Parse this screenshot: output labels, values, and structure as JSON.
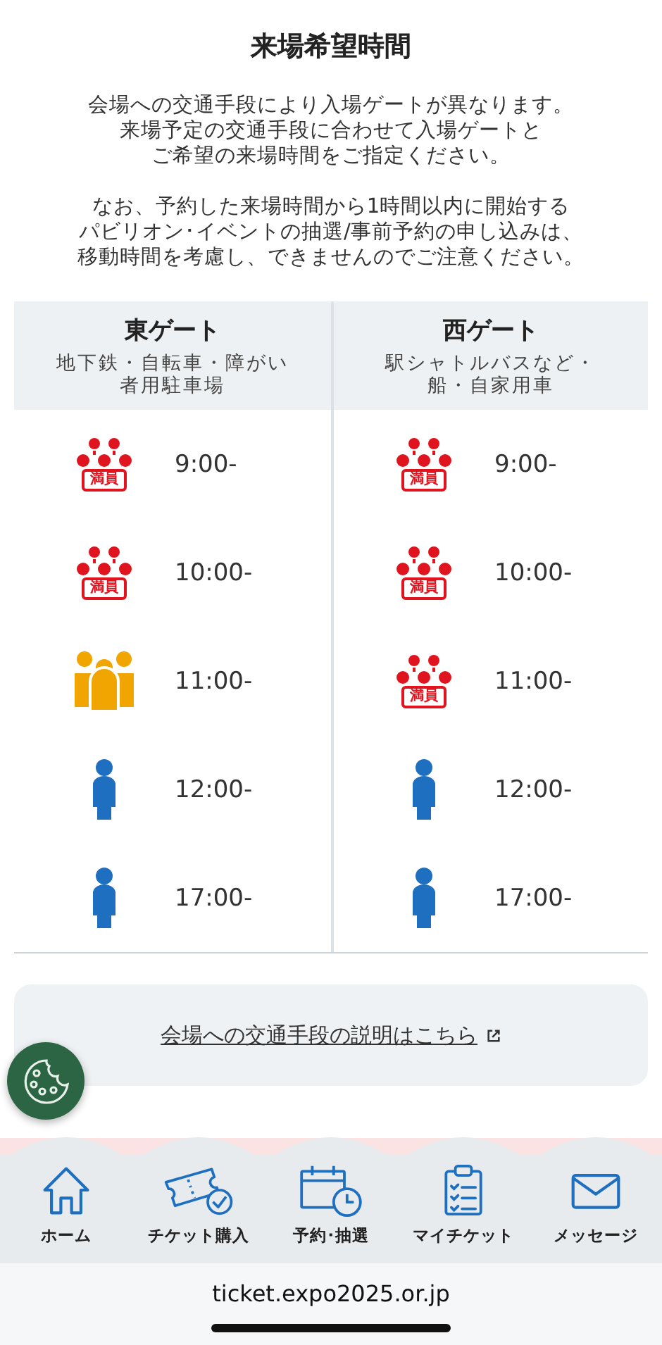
{
  "title": "来場希望時間",
  "intro": [
    "会場への交通手段により入場ゲートが異なります。",
    "来場予定の交通手段に合わせて入場ゲートと",
    "ご希望の来場時間をご指定ください。"
  ],
  "notice": [
    "なお、予約した来場時間から1時間以内に開始する",
    "パビリオン･イベントの抽選/事前予約の申し込みは、",
    "移動時間を考慮し、できませんのでご注意ください。"
  ],
  "gates": [
    {
      "name": "東ゲート",
      "means": [
        "地下鉄・自転車・障がい",
        "者用駐車場"
      ],
      "slots": [
        {
          "kind": "full",
          "badge": "満員",
          "time": "9:00-"
        },
        {
          "kind": "full",
          "badge": "満員",
          "time": "10:00-"
        },
        {
          "kind": "busy",
          "time": "11:00-"
        },
        {
          "kind": "available",
          "time": "12:00-"
        },
        {
          "kind": "available",
          "time": "17:00-"
        }
      ]
    },
    {
      "name": "西ゲート",
      "means": [
        "駅シャトルバスなど・",
        "船・自家用車"
      ],
      "slots": [
        {
          "kind": "full",
          "badge": "満員",
          "time": "9:00-"
        },
        {
          "kind": "full",
          "badge": "満員",
          "time": "10:00-"
        },
        {
          "kind": "full",
          "badge": "満員",
          "time": "11:00-"
        },
        {
          "kind": "available",
          "time": "12:00-"
        },
        {
          "kind": "available",
          "time": "17:00-"
        }
      ]
    }
  ],
  "transport_link": "会場への交通手段の説明はこちら",
  "nav": [
    {
      "kind": "home",
      "label": "ホーム"
    },
    {
      "kind": "ticket",
      "label": "チケット購入"
    },
    {
      "kind": "calendar",
      "label": "予約･抽選"
    },
    {
      "kind": "clipboard",
      "label": "マイチケット"
    },
    {
      "kind": "mail",
      "label": "メッセージ"
    }
  ],
  "url": "ticket.expo2025.or.jp"
}
